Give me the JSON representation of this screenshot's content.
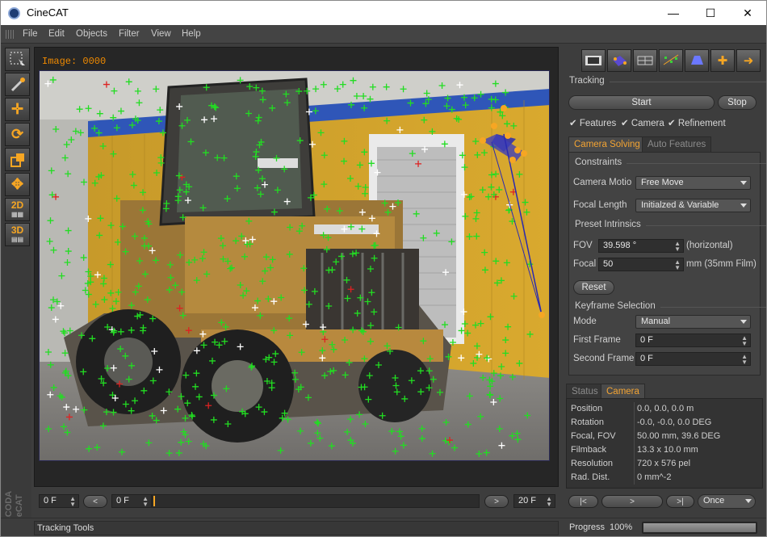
{
  "window": {
    "title": "CineCAT",
    "minimize": "—",
    "maximize": "☐",
    "close": "✕"
  },
  "menu": [
    "File",
    "Edit",
    "Objects",
    "Filter",
    "View",
    "Help"
  ],
  "left_tools": {
    "t2d": "2D",
    "t3d": "3D"
  },
  "brand": {
    "line1": "VISCODA",
    "line2": "CineCAT"
  },
  "viewport": {
    "image_label": "Image: 0000"
  },
  "tracking": {
    "section": "Tracking",
    "start": "Start",
    "stop": "Stop",
    "checks": [
      {
        "label": "Features",
        "checked": true
      },
      {
        "label": "Camera",
        "checked": true
      },
      {
        "label": "Refinement",
        "checked": true
      }
    ]
  },
  "solver_tabs": {
    "active": "Camera Solving",
    "inactive": "Auto Features"
  },
  "constraints": {
    "section": "Constraints",
    "camera_motion_label": "Camera Motio",
    "camera_motion_value": "Free Move",
    "focal_length_label": "Focal Length",
    "focal_length_value": "Initialzed & Variable"
  },
  "intrinsics": {
    "section": "Preset Intrinsics",
    "fov_label": "FOV",
    "fov_value": "39.598 °",
    "fov_unit": "(horizontal)",
    "focal_label": "Focal",
    "focal_value": "50",
    "focal_unit": "mm (35mm Film)",
    "reset": "Reset"
  },
  "keyframes": {
    "section": "Keyframe Selection",
    "mode_label": "Mode",
    "mode_value": "Manual",
    "first_label": "First Frame",
    "first_value": "0 F",
    "second_label": "Second Frame",
    "second_value": "0 F"
  },
  "info_tabs": {
    "inactive": "Status",
    "active": "Camera"
  },
  "camera_info": [
    {
      "k": "Position",
      "v": "0.0, 0.0, 0.0 m"
    },
    {
      "k": "Rotation",
      "v": "-0.0, -0.0, 0.0 DEG"
    },
    {
      "k": "Focal, FOV",
      "v": "50.00 mm, 39.6 DEG"
    },
    {
      "k": "Filmback",
      "v": "13.3 x 10.0 mm"
    },
    {
      "k": "Resolution",
      "v": "720 x 576 pel"
    },
    {
      "k": "Rad. Dist.",
      "v": "0 mm^-2"
    }
  ],
  "timeline": {
    "start": "0 F",
    "prev": "<",
    "current": "0 F",
    "next": ">",
    "end": "20 F"
  },
  "playback": {
    "first": "|<",
    "play": ">",
    "last": ">|",
    "mode": "Once"
  },
  "statusbar": {
    "left": "Tracking Tools",
    "progress_label": "Progress",
    "progress_value": "100%",
    "progress": 1.0
  },
  "colors": {
    "accent": "#f3a433",
    "track_green": "#22dd22",
    "track_white": "#ffffff",
    "track_red": "#dd2222",
    "camera_blue": "#2a2aa8"
  }
}
